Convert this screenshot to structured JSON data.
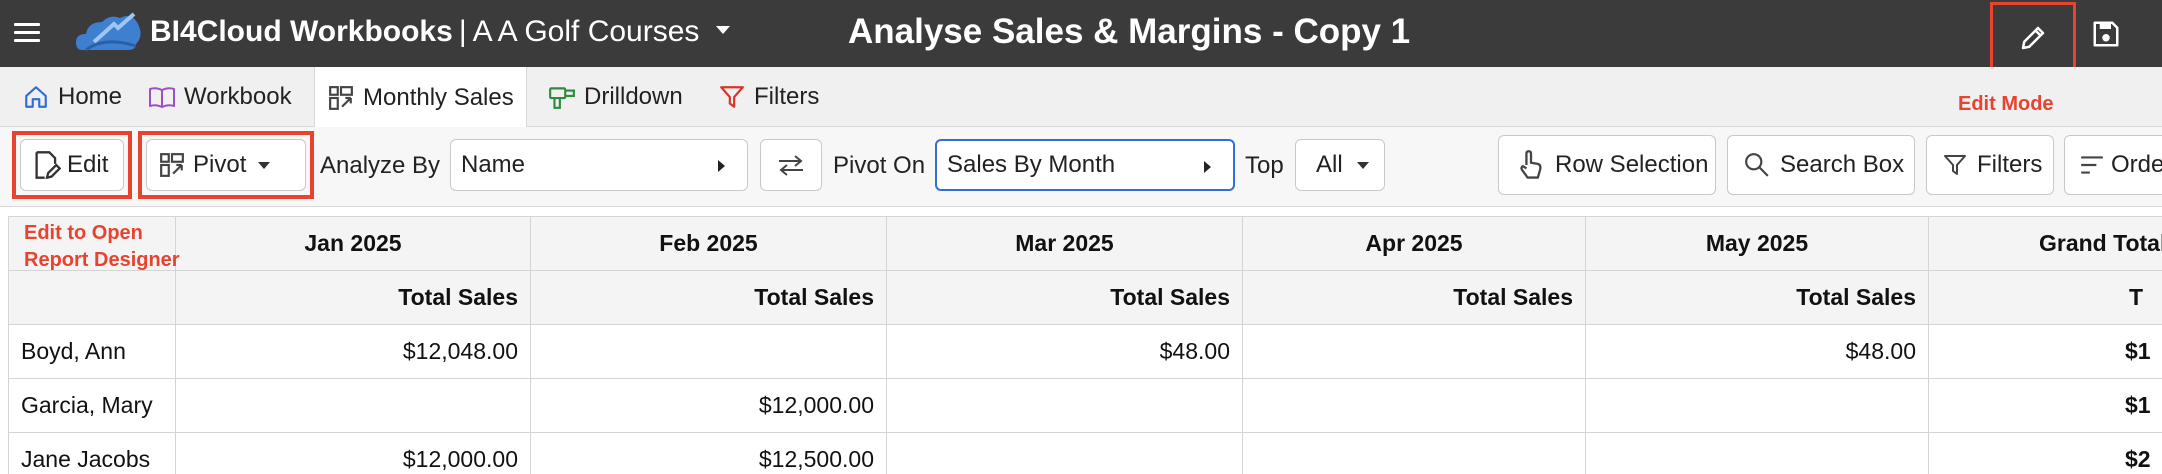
{
  "header": {
    "app_name": "BI4Cloud Workbooks",
    "separator": "|",
    "company": "A A Golf Courses",
    "page_title": "Analyse Sales & Margins  - Copy 1",
    "icons": {
      "menu": "hamburger-icon",
      "logo": "cloud-logo",
      "edit": "pencil-icon",
      "save": "save-icon"
    }
  },
  "tabs": [
    {
      "label": "Home",
      "icon": "home-icon",
      "color": "#2f6fd6"
    },
    {
      "label": "Workbook",
      "icon": "book-icon",
      "color": "#9b4fc9"
    },
    {
      "label": "Monthly Sales",
      "icon": "pivot-icon",
      "active": true
    },
    {
      "label": "Drilldown",
      "icon": "drill-icon",
      "color": "#2e8b3d"
    },
    {
      "label": "Filters",
      "icon": "filter-icon",
      "color": "#d9352b"
    }
  ],
  "annotations": {
    "edit_mode": "Edit Mode",
    "edit_hint_line1": "Edit to Open",
    "edit_hint_line2": "Report Designer",
    "highlight_color": "#e8432f"
  },
  "toolbar": {
    "edit_label": "Edit",
    "pivot_label": "Pivot",
    "analyze_by_label": "Analyze By",
    "analyze_by_value": "Name",
    "pivot_on_label": "Pivot On",
    "pivot_on_value": "Sales By Month",
    "top_label": "Top",
    "top_value": "All",
    "row_selection_label": "Row Selection",
    "search_box_label": "Search Box",
    "filters_label": "Filters",
    "order_label": "Order"
  },
  "grid": {
    "months": [
      "Jan 2025",
      "Feb 2025",
      "Mar 2025",
      "Apr 2025",
      "May 2025",
      "Grand Total"
    ],
    "measure": "Total Sales",
    "measure_short": "T",
    "rows": [
      {
        "name": "Boyd, Ann",
        "values": [
          "$12,048.00",
          "",
          "$48.00",
          "",
          "$48.00",
          "$1"
        ]
      },
      {
        "name": "Garcia, Mary",
        "values": [
          "",
          "$12,000.00",
          "",
          "",
          "",
          "$1"
        ]
      },
      {
        "name": "Jane Jacobs",
        "values": [
          "$12,000.00",
          "$12,500.00",
          "",
          "",
          "",
          "$2"
        ]
      }
    ]
  }
}
